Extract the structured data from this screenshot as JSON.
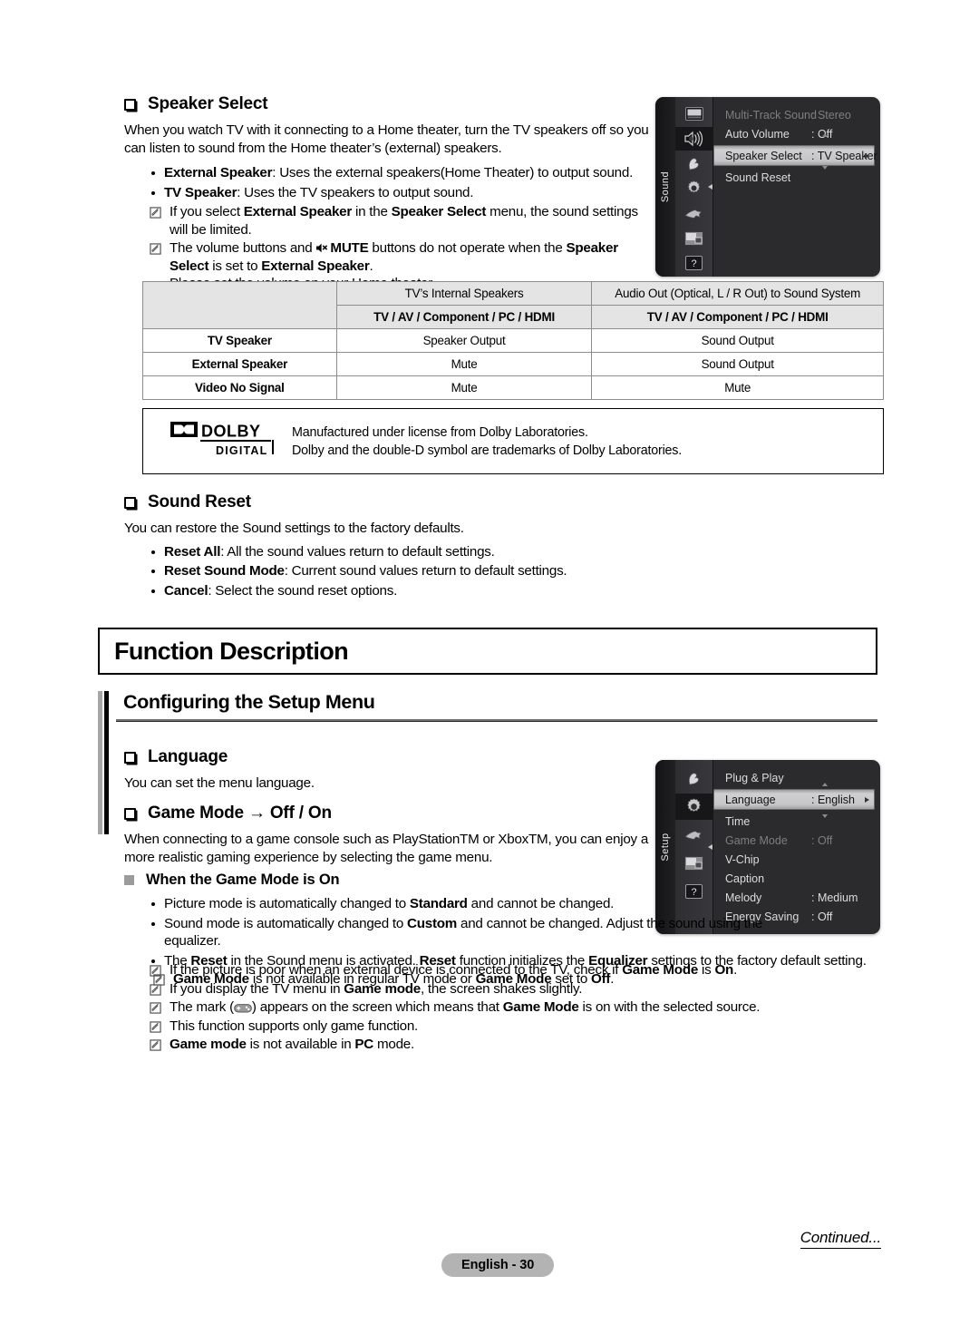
{
  "speaker_select": {
    "heading": "Speaker Select",
    "intro": "When you watch TV with it connecting to a Home theater, turn the TV speakers off so you can listen to sound from the Home theater’s (external) speakers.",
    "bullets": [
      {
        "term": "External Speaker",
        "rest": ": Uses the external speakers(Home Theater) to output sound."
      },
      {
        "term": "TV Speaker",
        "rest": ": Uses the TV speakers to output sound."
      }
    ],
    "note1_pre": "If you select ",
    "note1_b1": "External Speaker",
    "note1_mid": " in the ",
    "note1_b2": "Speaker Select",
    "note1_post": " menu, the sound settings will be limited.",
    "note2_pre": "The volume buttons and ",
    "note2_mute": "MUTE",
    "note2_mid": " buttons do not operate when the ",
    "note2_b2": "Speaker Select",
    "note2_post": " is set to ",
    "note2_b3": "External Speaker",
    "note2_end": ".",
    "note2_line2": "Please set the volume on your Home theater."
  },
  "osd_sound": {
    "tab_label": "Sound",
    "rail_icons": [
      "picture-icon",
      "sound-icon",
      "channel-icon",
      "setup-icon",
      "input-icon",
      "pip-icon",
      "support-icon"
    ],
    "rows": [
      {
        "label": "Multi-Track Sound",
        "value": ": Stereo",
        "state": "dim"
      },
      {
        "label": "Auto Volume",
        "value": ": Off",
        "state": "normal"
      },
      {
        "label": "Speaker Select",
        "value": ": TV Speaker",
        "state": "highlight"
      },
      {
        "label": "Sound Reset",
        "value": "",
        "state": "normal"
      }
    ]
  },
  "speaker_table": {
    "header_top": [
      "",
      "TV’s Internal Speakers",
      "Audio Out (Optical, L / R Out) to Sound System"
    ],
    "header_sub": [
      "TV / AV / Component / PC / HDMI",
      "TV / AV / Component / PC / HDMI"
    ],
    "rows": [
      {
        "label": "TV Speaker",
        "internal": "Speaker Output",
        "audio_out": "Sound Output"
      },
      {
        "label": "External Speaker",
        "internal": "Mute",
        "audio_out": "Sound Output"
      },
      {
        "label": "Video No Signal",
        "internal": "Mute",
        "audio_out": "Mute"
      }
    ]
  },
  "dolby": {
    "logo_word": "DOLBY",
    "logo_sub": "DIGITAL",
    "line1": "Manufactured under license from Dolby Laboratories.",
    "line2": "Dolby and the double-D symbol are trademarks of Dolby Laboratories."
  },
  "sound_reset": {
    "heading": "Sound Reset",
    "intro": "You can restore the Sound settings to the factory defaults.",
    "bullets": [
      {
        "term": "Reset All",
        "rest": ": All the sound values return to default settings."
      },
      {
        "term": "Reset Sound Mode",
        "rest": ": Current sound values return to default settings."
      },
      {
        "term": "Cancel",
        "rest": ": Select the sound reset options."
      }
    ]
  },
  "function_description": {
    "title": "Function Description"
  },
  "configuring": {
    "title": "Configuring the Setup Menu"
  },
  "language": {
    "heading": "Language",
    "intro": "You can set the menu language."
  },
  "game_mode": {
    "heading": "Game Mode → Off / On",
    "intro": "When connecting to a game console such as PlayStationTM or XboxTM, you can enjoy a more realistic gaming experience by selecting the game menu."
  },
  "osd_setup": {
    "tab_label": "Setup",
    "rail_icons": [
      "channel-icon",
      "setup-icon",
      "input-icon",
      "pip-icon",
      "support-icon"
    ],
    "rows": [
      {
        "label": "Plug & Play",
        "value": "",
        "state": "normal"
      },
      {
        "label": "Language",
        "value": ": English",
        "state": "highlight"
      },
      {
        "label": "Time",
        "value": "",
        "state": "normal"
      },
      {
        "label": "Game Mode",
        "value": ": Off",
        "state": "dim"
      },
      {
        "label": "V-Chip",
        "value": "",
        "state": "normal"
      },
      {
        "label": "Caption",
        "value": "",
        "state": "normal"
      },
      {
        "label": "Melody",
        "value": ": Medium",
        "state": "normal"
      },
      {
        "label": "Energy Saving",
        "value": ": Off",
        "state": "normal"
      }
    ]
  },
  "game_when": {
    "heading": "When the Game Mode is On",
    "bullets": [
      {
        "pre": "Picture mode is automatically changed to ",
        "b1": "Standard",
        "post": " and cannot be changed."
      },
      {
        "pre": "Sound mode is automatically changed to ",
        "b1": "Custom",
        "post": " and cannot be changed. Adjust the sound using the equalizer."
      },
      {
        "pre": "The ",
        "b1": "Reset",
        "mid": " in the Sound menu is activated. ",
        "b2": "Reset",
        "mid2": " function initializes the ",
        "b3": "Equalizer",
        "post": " settings to the factory default setting."
      }
    ],
    "note_first": {
      "b1": "Game Mode",
      "mid": " is not available in regular TV mode or ",
      "b2": "Game Mode",
      "mid2": " set to ",
      "b3": "Off",
      "post": "."
    }
  },
  "game_notes": [
    {
      "pre": "If the picture is poor when an external device is connected to the TV, check if ",
      "b1": "Game Mode",
      "mid": " is ",
      "b2": "On",
      "post": "."
    },
    {
      "pre": "If you display the TV menu in ",
      "b1": "Game mode",
      "post": ", the screen shakes slightly."
    },
    {
      "pre": "The mark (",
      "icon": "gamepad-icon",
      "mid": ") appears on the screen which means that ",
      "b1": "Game Mode",
      "post": " is on with the selected source."
    },
    {
      "pre": "This function supports only game function.",
      "post": ""
    },
    {
      "b1": "Game mode",
      "post": " is not available in ",
      "b2": "PC",
      "post2": " mode."
    }
  ],
  "footer": {
    "continued": "Continued...",
    "page_label": "English - 30"
  }
}
